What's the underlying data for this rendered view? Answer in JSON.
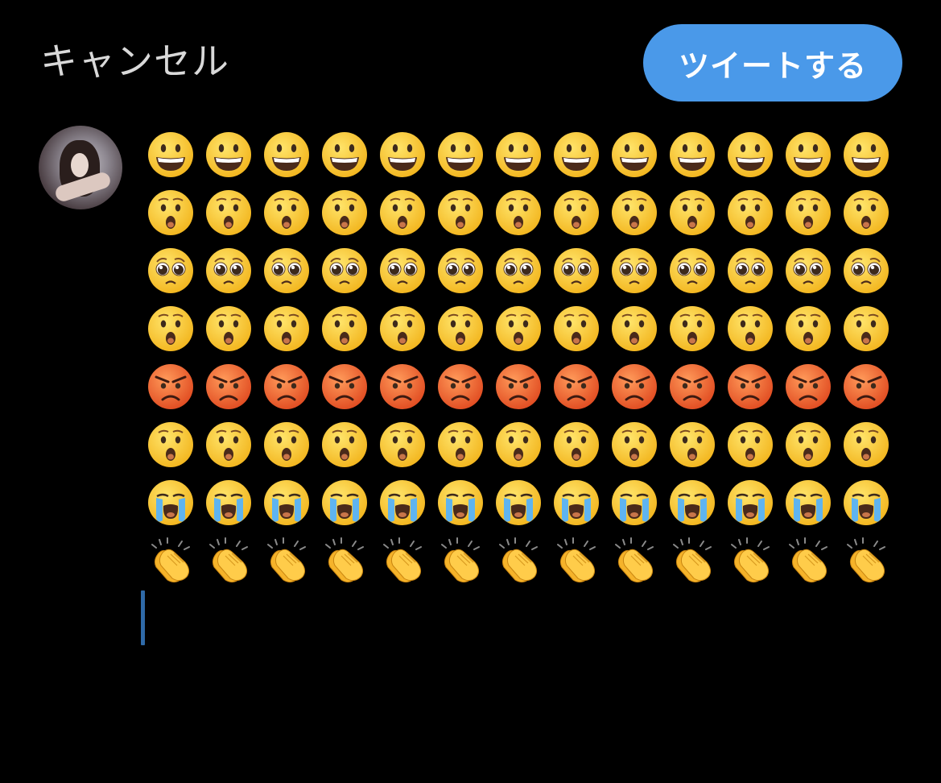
{
  "header": {
    "cancel_label": "キャンセル",
    "tweet_label": "ツイートする"
  },
  "colors": {
    "background": "#000000",
    "accent": "#4a99e9",
    "cursor": "#2f6aa8",
    "cancel_text": "#d9d9d9"
  },
  "avatar": {
    "icon": "user-avatar-photo"
  },
  "compose": {
    "columns": 13,
    "rows": [
      {
        "emoji": "grinning-face",
        "count": 13
      },
      {
        "emoji": "hushed-face",
        "count": 13
      },
      {
        "emoji": "pleading-face",
        "count": 13
      },
      {
        "emoji": "hushed-face",
        "count": 13
      },
      {
        "emoji": "angry-face",
        "count": 13
      },
      {
        "emoji": "hushed-face",
        "count": 13
      },
      {
        "emoji": "loudly-crying-face",
        "count": 13
      },
      {
        "emoji": "clapping-hands",
        "count": 13
      }
    ]
  }
}
